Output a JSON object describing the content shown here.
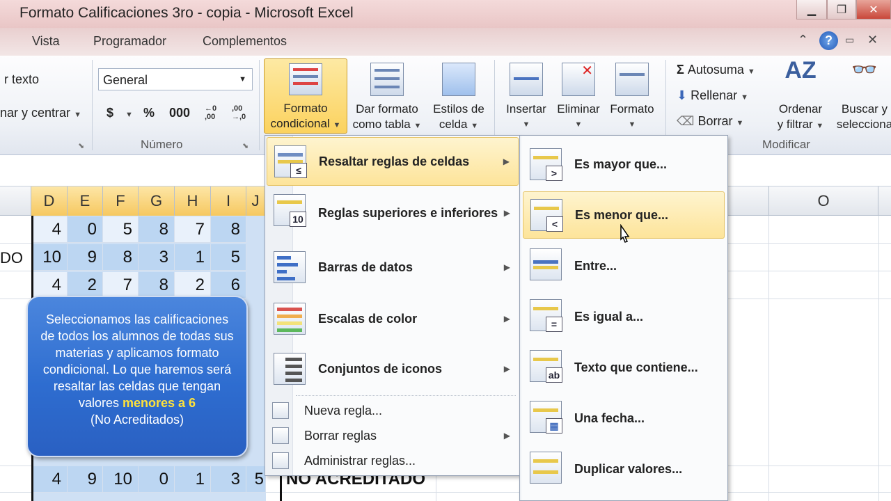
{
  "window": {
    "title": "Formato Calificaciones 3ro - copia  -  Microsoft Excel"
  },
  "menu_tabs": [
    "Vista",
    "Programador",
    "Complementos"
  ],
  "ribbon": {
    "alignment": {
      "wrap_text": "r texto",
      "merge_center": "nar y centrar"
    },
    "number": {
      "format_value": "General",
      "currency": "$",
      "percent": "%",
      "thousands": "000",
      "inc_decimal": "←0 ,00",
      "dec_decimal": ",00 →,0",
      "group_label": "Número"
    },
    "styles": {
      "conditional_format": [
        "Formato",
        "condicional"
      ],
      "format_table": [
        "Dar formato",
        "como tabla"
      ],
      "cell_styles": [
        "Estilos de",
        "celda"
      ]
    },
    "cells": {
      "insert": "Insertar",
      "delete": "Eliminar",
      "format": "Formato"
    },
    "editing": {
      "autosum": "Autosuma",
      "fill": "Rellenar",
      "clear": "Borrar",
      "sort_filter": [
        "Ordenar",
        "y filtrar"
      ],
      "find_select": [
        "Buscar y",
        "selecciona"
      ],
      "group_label": "Modificar"
    }
  },
  "grid": {
    "columns": [
      "D",
      "E",
      "F",
      "G",
      "H",
      "I",
      "J",
      "O"
    ],
    "row_fragment": "DO",
    "rows": [
      [
        4,
        0,
        5,
        8,
        7,
        8
      ],
      [
        10,
        9,
        8,
        3,
        1,
        5
      ],
      [
        4,
        2,
        7,
        8,
        2,
        6
      ],
      [
        4,
        9,
        10,
        0,
        1,
        3,
        5
      ]
    ],
    "status_text": "NO ACREDITADO"
  },
  "callout": {
    "text": "Seleccionamos las calificaciones de todos los alumnos de todas sus materias y aplicamos formato condicional. Lo que haremos será resaltar las celdas que tengan valores",
    "highlight": "menores a 6",
    "tail": "(No Acreditados)"
  },
  "conditional_menu": {
    "items": [
      {
        "label": "Resaltar reglas de celdas",
        "icon": "highlight-rules-icon",
        "submenu": true,
        "active": true
      },
      {
        "label": "Reglas superiores e inferiores",
        "icon": "top-bottom-rules-icon",
        "submenu": true
      },
      {
        "label": "Barras de datos",
        "icon": "data-bars-icon",
        "submenu": true
      },
      {
        "label": "Escalas de color",
        "icon": "color-scales-icon",
        "submenu": true
      },
      {
        "label": "Conjuntos de iconos",
        "icon": "icon-sets-icon",
        "submenu": true
      }
    ],
    "small_items": [
      {
        "label": "Nueva regla...",
        "icon": "new-rule-icon"
      },
      {
        "label": "Borrar reglas",
        "icon": "clear-rules-icon",
        "submenu": true
      },
      {
        "label": "Administrar reglas...",
        "icon": "manage-rules-icon"
      }
    ]
  },
  "highlight_submenu": {
    "items": [
      {
        "label": "Es mayor que...",
        "badge": ">"
      },
      {
        "label": "Es menor que...",
        "badge": "<",
        "hovered": true
      },
      {
        "label": "Entre...",
        "badge": ""
      },
      {
        "label": "Es igual a...",
        "badge": "="
      },
      {
        "label": "Texto que contiene...",
        "badge": "ab"
      },
      {
        "label": "Una fecha...",
        "badge": "▦"
      },
      {
        "label": "Duplicar valores...",
        "badge": ""
      }
    ]
  },
  "colors": {
    "accent_hover": "#fde49a",
    "selection": "#bcd6f2",
    "callout": "#2e6dd0",
    "highlight_text": "#ffe23a"
  }
}
